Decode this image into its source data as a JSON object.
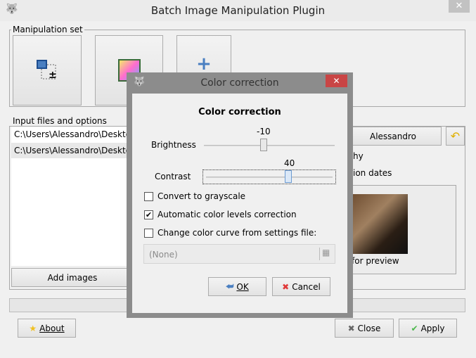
{
  "window": {
    "title": "Batch Image Manipulation Plugin",
    "close": "✕"
  },
  "manipulation": {
    "legend": "Manipulation set"
  },
  "input": {
    "legend": "Input files and options",
    "files": [
      "C:\\Users\\Alessandro\\Desktop\\",
      "C:\\Users\\Alessandro\\Desktop\\"
    ],
    "add_images": "Add images",
    "folder_button": "Alessandro",
    "partial_1": "hy",
    "partial_2": "ion dates",
    "preview_text": "for preview"
  },
  "footer": {
    "about": "About",
    "close": "Close",
    "apply": "Apply"
  },
  "dialog": {
    "title": "Color correction",
    "close": "✕",
    "heading": "Color correction",
    "brightness_label": "Brightness",
    "brightness_value": "-10",
    "contrast_label": "Contrast",
    "contrast_value": "40",
    "grayscale": {
      "label": "Convert to grayscale",
      "checked": false
    },
    "autolevels": {
      "label": "Automatic color levels correction",
      "checked": true
    },
    "curve": {
      "label": "Change color curve from settings file:",
      "checked": false
    },
    "file_value": "(None)",
    "ok": "OK",
    "cancel": "Cancel"
  }
}
